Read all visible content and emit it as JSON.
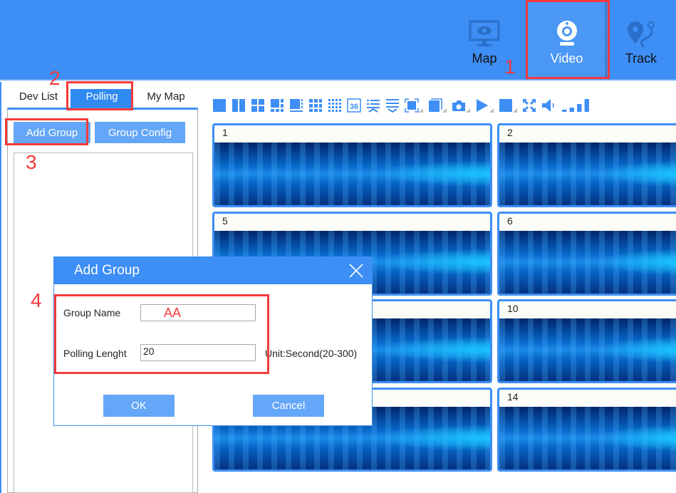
{
  "header": {
    "nav": [
      {
        "label": "Map",
        "icon": "monitor-eye-icon"
      },
      {
        "label": "Video",
        "icon": "webcam-icon",
        "active": true
      },
      {
        "label": "Track",
        "icon": "route-pin-icon"
      }
    ]
  },
  "left": {
    "tabs": [
      "Dev List",
      "Polling",
      "My Map"
    ],
    "active_tab": "Polling",
    "buttons": {
      "add_group": "Add Group",
      "group_config": "Group Config"
    }
  },
  "toolbar": {
    "icons": [
      "layout-1-icon",
      "layout-2-icon",
      "layout-4-icon",
      "layout-6-icon",
      "layout-8-icon",
      "layout-9-icon",
      "layout-16-icon",
      "layout-36-icon",
      "list-expand-icon",
      "list-collapse-icon",
      "fit-screen-icon",
      "window-icon",
      "camera-snapshot-icon",
      "play-icon",
      "stop-icon",
      "fullscreen-icon",
      "volume-icon",
      "signal-icon"
    ]
  },
  "tiles": [
    "1",
    "2",
    "5",
    "6",
    "",
    "10",
    "",
    "14"
  ],
  "dialog": {
    "title": "Add Group",
    "group_name_label": "Group Name",
    "group_name_value": "AA",
    "polling_label": "Polling Lenght",
    "polling_value": "20",
    "unit_text": "Unit:Second(20-300)",
    "ok": "OK",
    "cancel": "Cancel"
  },
  "annotations": {
    "n1": "1",
    "n2": "2",
    "n3": "3",
    "n4": "4",
    "color": "#f33b3b"
  },
  "colors": {
    "primary": "#3d8ef5",
    "button": "#64a6f7"
  }
}
